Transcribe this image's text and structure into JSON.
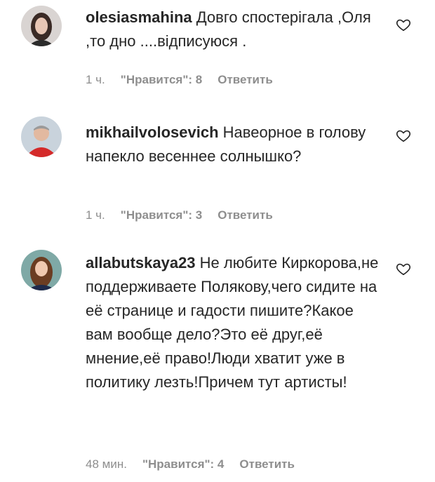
{
  "comments": [
    {
      "username": "olesiasmahina",
      "text": "Довго спостерігала ,Оля ,то дно ....відписуюся .",
      "time": "1 ч.",
      "likes": "\"Нравится\": 8",
      "reply": "Ответить"
    },
    {
      "username": "mikhailvolosevich",
      "text": "Навеорное в голову напекло весеннее солнышко?",
      "time": "1 ч.",
      "likes": "\"Нравится\": 3",
      "reply": "Ответить"
    },
    {
      "username": "allabutskaya23",
      "text": "Не любите Киркорова,не поддерживаете Полякову,чего сидите на её странице и гадости пишите?Какое вам вообще дело?Это её друг,её мнение,её право!Люди хватит уже в политику лезть!Причем тут артисты!",
      "time": "48 мин.",
      "likes": "\"Нравится\": 4",
      "reply": "Ответить"
    }
  ],
  "icons": {
    "like": "heart-outline-icon",
    "avatar": "user-avatar"
  },
  "colors": {
    "text": "#262626",
    "meta": "#8e8e8e",
    "background": "#ffffff"
  }
}
